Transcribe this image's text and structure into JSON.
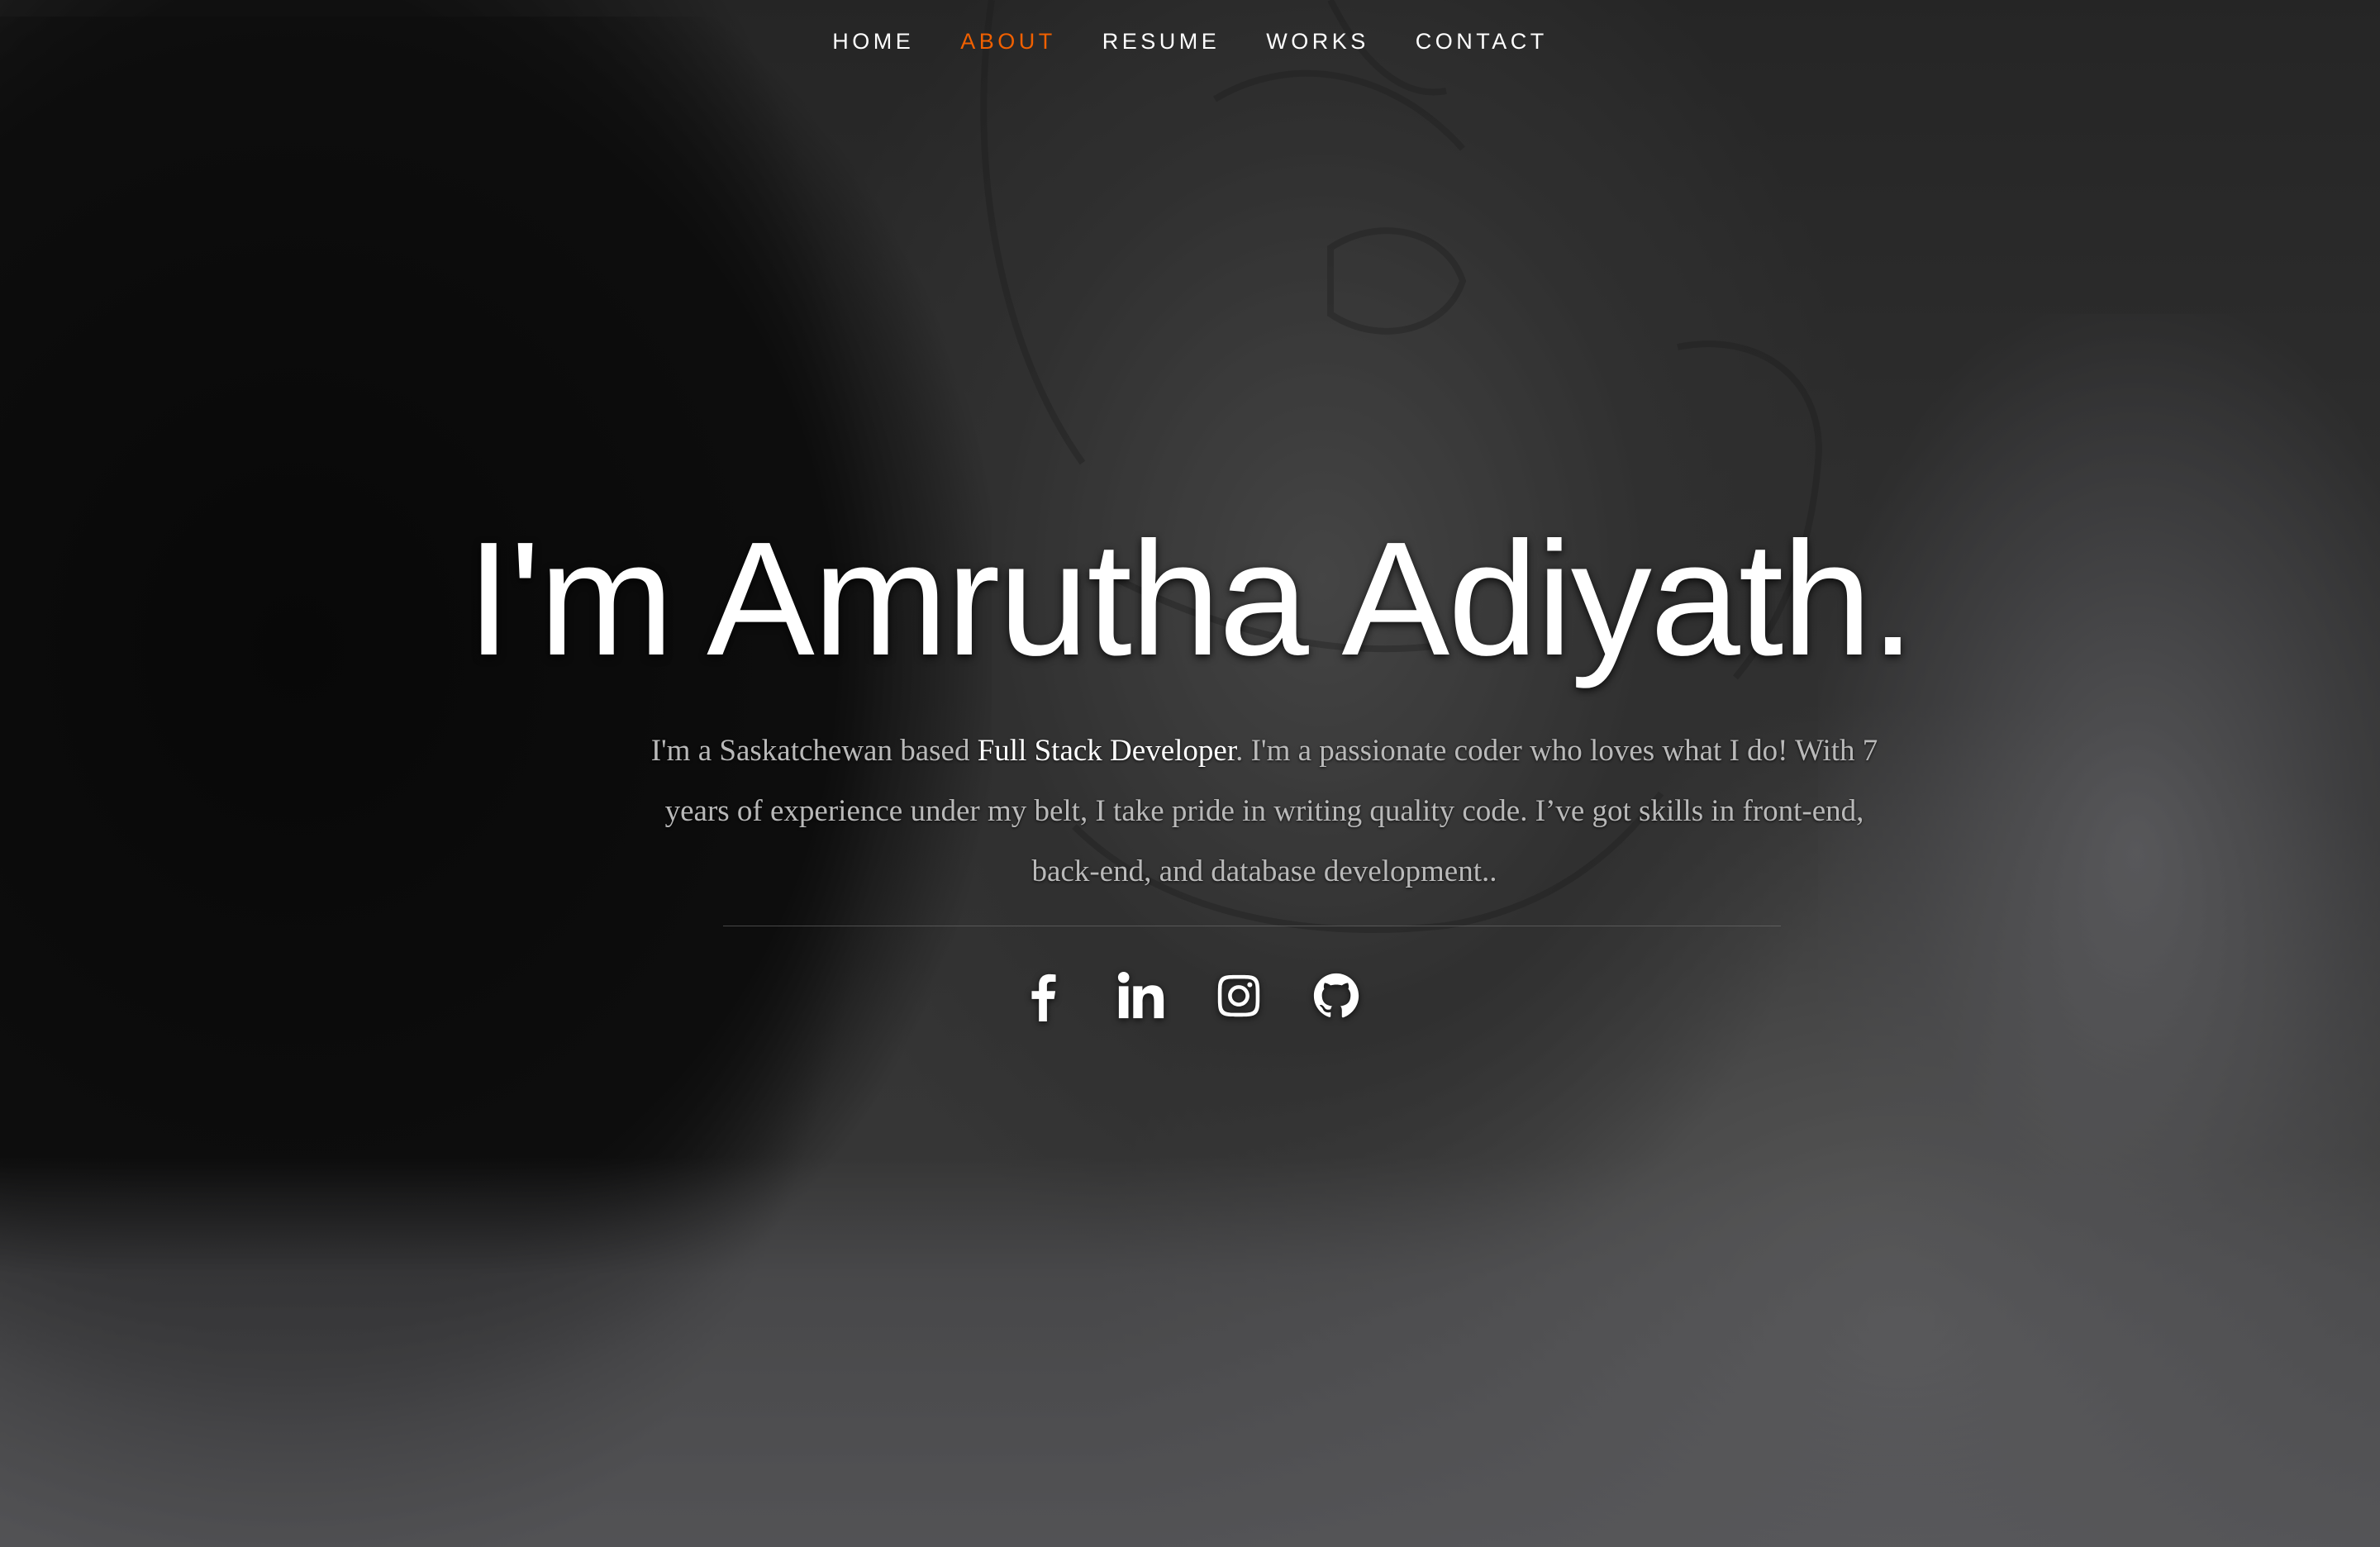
{
  "nav": {
    "items": [
      {
        "label": "Home",
        "active": false
      },
      {
        "label": "About",
        "active": true
      },
      {
        "label": "Resume",
        "active": false
      },
      {
        "label": "Works",
        "active": false
      },
      {
        "label": "Contact",
        "active": false
      }
    ]
  },
  "hero": {
    "title": "I'm Amrutha Adiyath.",
    "intro_before": "I'm a Saskatchewan based ",
    "intro_highlight": "Full Stack Developer",
    "intro_after": ". I'm a passionate coder who loves what I do! With 7 years of experience under my belt, I take pride in writing quality code. I’ve got skills in front-end, back-end, and database development.."
  },
  "social": [
    {
      "icon": "facebook-icon"
    },
    {
      "icon": "linkedin-icon"
    },
    {
      "icon": "instagram-icon"
    },
    {
      "icon": "github-icon"
    }
  ],
  "colors": {
    "accent": "#f06000",
    "text": "#ffffff",
    "body_text": "#b9b9b9"
  }
}
